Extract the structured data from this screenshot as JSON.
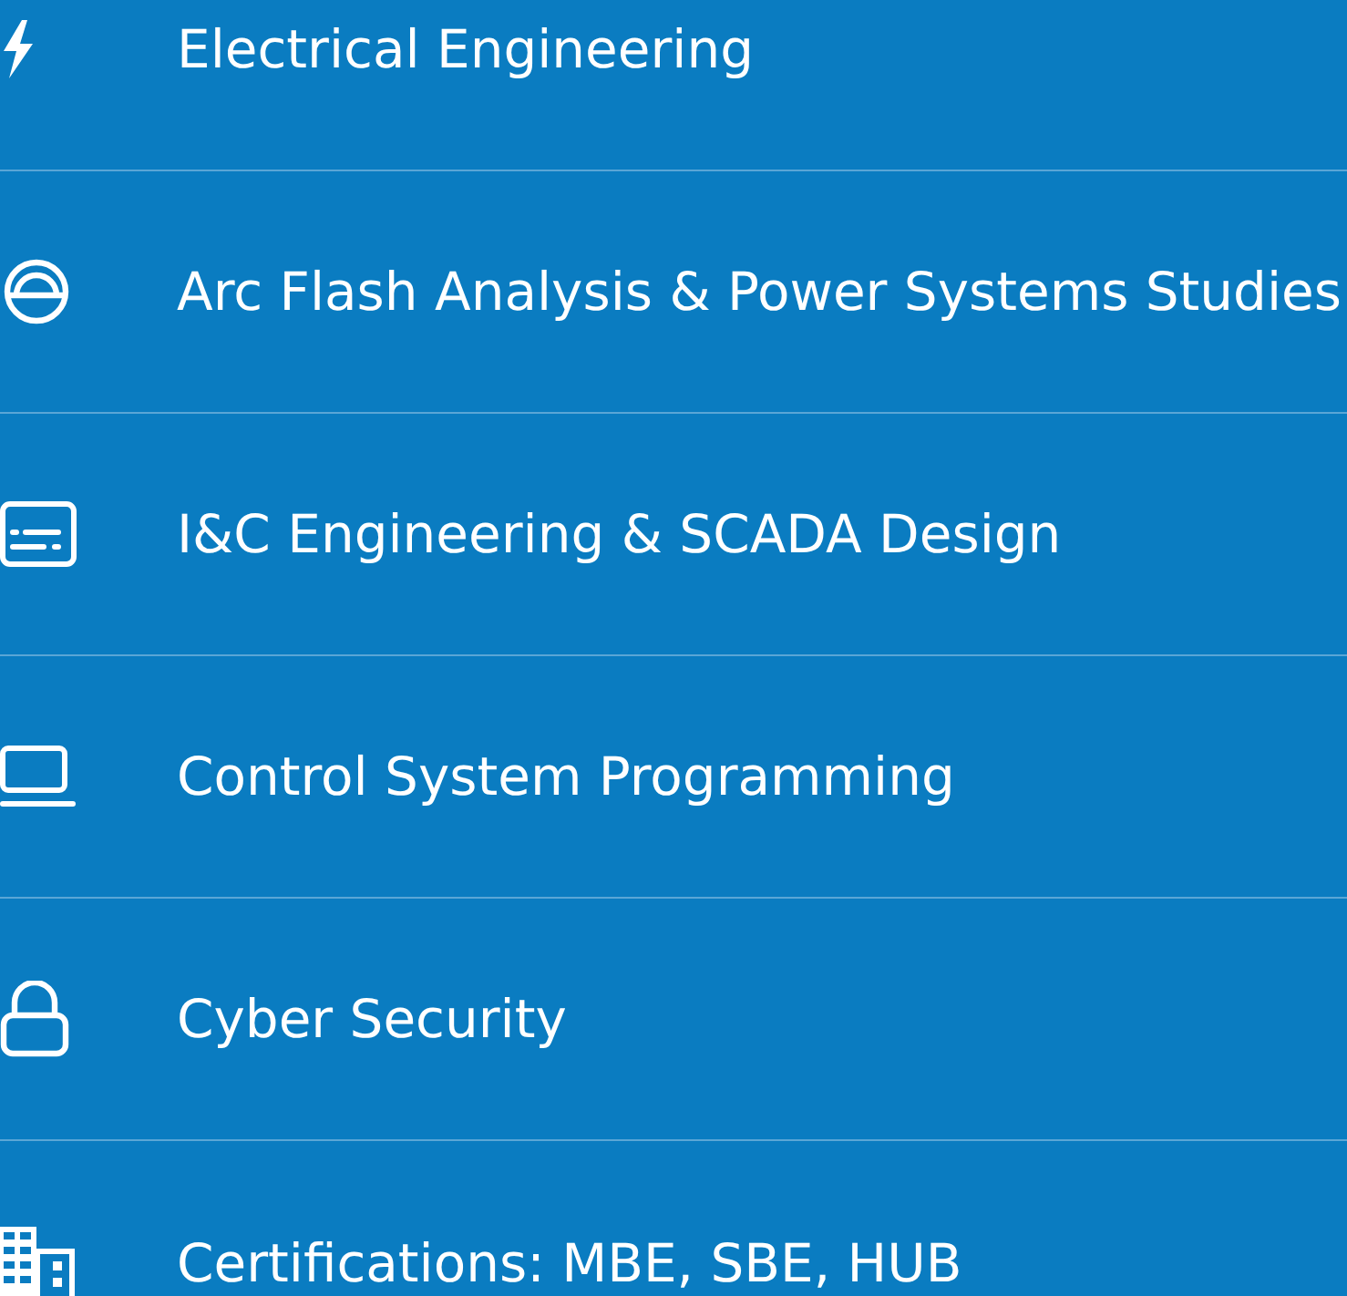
{
  "services": [
    {
      "label": "Electrical Engineering"
    },
    {
      "label": "Arc Flash Analysis & Power Systems Studies"
    },
    {
      "label": "I&C Engineering & SCADA Design"
    },
    {
      "label": "Control System Programming"
    },
    {
      "label": "Cyber Security"
    },
    {
      "label": "Certifications: MBE, SBE, HUB"
    }
  ]
}
